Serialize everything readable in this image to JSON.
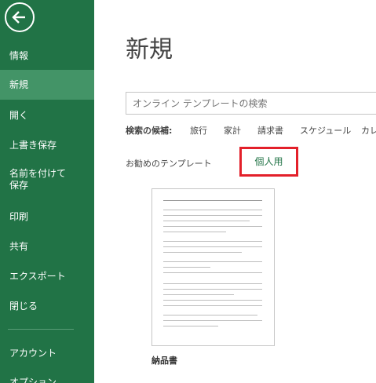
{
  "sidebar": {
    "items": [
      {
        "label": "情報"
      },
      {
        "label": "新規"
      },
      {
        "label": "開く"
      },
      {
        "label": "上書き保存"
      },
      {
        "label_line1": "名前を付けて",
        "label_line2": "保存"
      },
      {
        "label": "印刷"
      },
      {
        "label": "共有"
      },
      {
        "label": "エクスポート"
      },
      {
        "label": "閉じる"
      },
      {
        "label": "アカウント"
      },
      {
        "label": "オプション"
      }
    ]
  },
  "main": {
    "title": "新規",
    "search": {
      "placeholder": "オンライン テンプレートの検索"
    },
    "suggested": {
      "label": "検索の候補:",
      "items": [
        "旅行",
        "家計",
        "請求書",
        "スケジュール",
        "カレ"
      ]
    },
    "tabs": {
      "featured": "お勧めのテンプレート",
      "personal": "個人用"
    },
    "templates": [
      {
        "name": "納品書"
      }
    ]
  },
  "colors": {
    "sidebar_bg": "#217346",
    "sidebar_active": "#439467",
    "highlight_box": "#e3202a"
  }
}
